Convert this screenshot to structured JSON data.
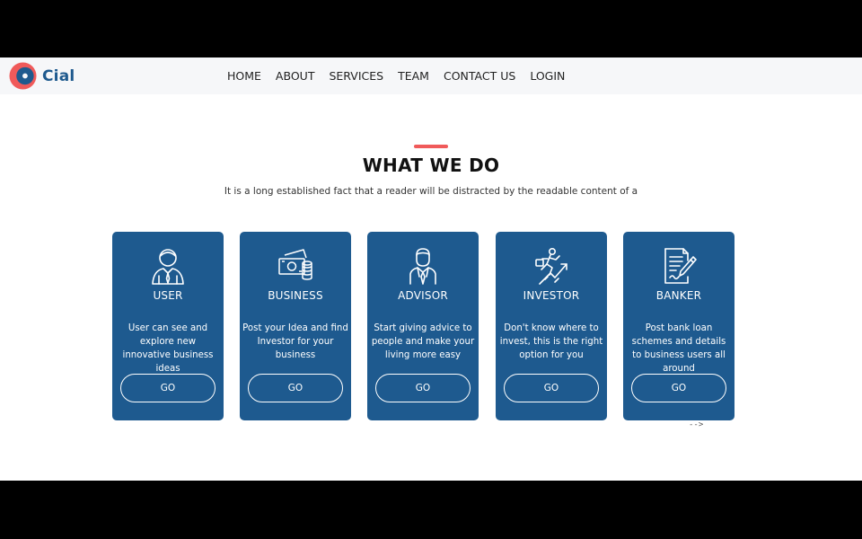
{
  "brand": {
    "name": "Cial"
  },
  "nav": [
    "HOME",
    "ABOUT",
    "SERVICES",
    "TEAM",
    "CONTACT US",
    "LOGIN"
  ],
  "section": {
    "title": "WHAT WE DO",
    "subtitle": "It is a long established fact that a reader will be distracted by the readable content of a"
  },
  "cards": [
    {
      "title": "USER",
      "icon": "user-icon",
      "desc": "User can see and explore new innovative business ideas",
      "button": "GO"
    },
    {
      "title": "BUSINESS",
      "icon": "money-icon",
      "desc": "Post your Idea and find Investor for your business",
      "button": "GO"
    },
    {
      "title": "ADVISOR",
      "icon": "advisor-icon",
      "desc": "Start giving advice to people and make your living more easy",
      "button": "GO"
    },
    {
      "title": "INVESTOR",
      "icon": "investor-growth-icon",
      "desc": "Don't know where to invest, this is the right option for you",
      "button": "GO"
    },
    {
      "title": "BANKER",
      "icon": "document-pen-icon",
      "desc": "Post bank loan schemes and details to business users all around",
      "button": "GO"
    }
  ],
  "scroll_hint": "-->",
  "colors": {
    "primary": "#1e5a8f",
    "accent": "#f05a5a",
    "header_bg": "#f6f7f9"
  }
}
